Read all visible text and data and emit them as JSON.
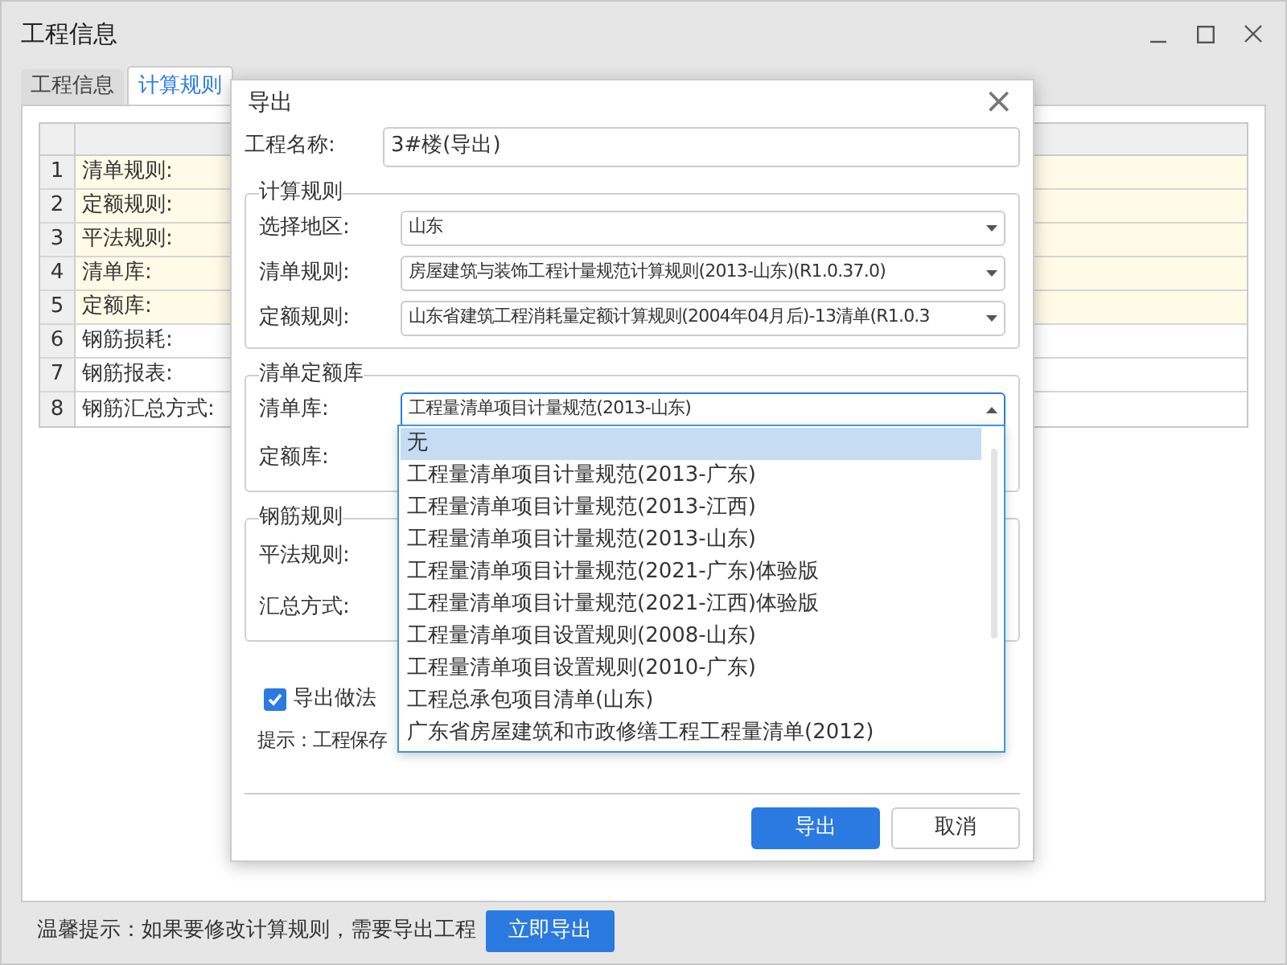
{
  "window": {
    "title": "工程信息"
  },
  "tabs": [
    {
      "label": "工程信息",
      "selected": false
    },
    {
      "label": "计算规则",
      "selected": true
    }
  ],
  "table": {
    "rows": [
      {
        "index": "1",
        "name": "清单规则:",
        "highlighted": true
      },
      {
        "index": "2",
        "name": "定额规则:",
        "highlighted": true
      },
      {
        "index": "3",
        "name": "平法规则:",
        "highlighted": true
      },
      {
        "index": "4",
        "name": "清单库:",
        "highlighted": true
      },
      {
        "index": "5",
        "name": "定额库:",
        "highlighted": true
      },
      {
        "index": "6",
        "name": "钢筋损耗:",
        "highlighted": false
      },
      {
        "index": "7",
        "name": "钢筋报表:",
        "highlighted": false
      },
      {
        "index": "8",
        "name": "钢筋汇总方式:",
        "highlighted": false
      }
    ]
  },
  "footer": {
    "hint": "温馨提示：如果要修改计算规则，需要导出工程",
    "button": "立即导出"
  },
  "dialog": {
    "title": "导出",
    "close": "×",
    "name_label": "工程名称:",
    "name_value": "3#楼(导出)",
    "groups": [
      {
        "title": "计算规则",
        "fields": [
          {
            "label": "选择地区:",
            "value": "山东",
            "kind": "select",
            "open": false
          },
          {
            "label": "清单规则:",
            "value": "房屋建筑与装饰工程计量规范计算规则(2013-山东)(R1.0.37.0)",
            "kind": "select",
            "open": false
          },
          {
            "label": "定额规则:",
            "value": "山东省建筑工程消耗量定额计算规则(2004年04月后)-13清单(R1.0.3",
            "kind": "select",
            "open": false
          }
        ]
      },
      {
        "title": "清单定额库",
        "fields": [
          {
            "label": "清单库:",
            "value": "工程量清单项目计量规范(2013-山东)",
            "kind": "select",
            "open": true
          },
          {
            "label": "定额库:",
            "kind": "label"
          }
        ]
      },
      {
        "title": "钢筋规则",
        "fields": [
          {
            "label": "平法规则:",
            "kind": "label"
          },
          {
            "label": "汇总方式:",
            "kind": "label"
          }
        ]
      }
    ],
    "checkbox": {
      "label": "导出做法",
      "checked": true
    },
    "hint": "提示：工程保存",
    "buttons": [
      {
        "label": "导出",
        "primary": true
      },
      {
        "label": "取消",
        "primary": false
      }
    ],
    "dropdown": [
      {
        "label": "无",
        "selected": true
      },
      {
        "label": "工程量清单项目计量规范(2013-广东)",
        "selected": false
      },
      {
        "label": "工程量清单项目计量规范(2013-江西)",
        "selected": false
      },
      {
        "label": "工程量清单项目计量规范(2013-山东)",
        "selected": false
      },
      {
        "label": "工程量清单项目计量规范(2021-广东)体验版",
        "selected": false
      },
      {
        "label": "工程量清单项目计量规范(2021-江西)体验版",
        "selected": false
      },
      {
        "label": "工程量清单项目设置规则(2008-山东)",
        "selected": false
      },
      {
        "label": "工程量清单项目设置规则(2010-广东)",
        "selected": false
      },
      {
        "label": "工程总承包项目清单(山东)",
        "selected": false
      },
      {
        "label": "广东省房屋建筑和市政修缮工程工程量清单(2012)",
        "selected": false
      }
    ]
  }
}
